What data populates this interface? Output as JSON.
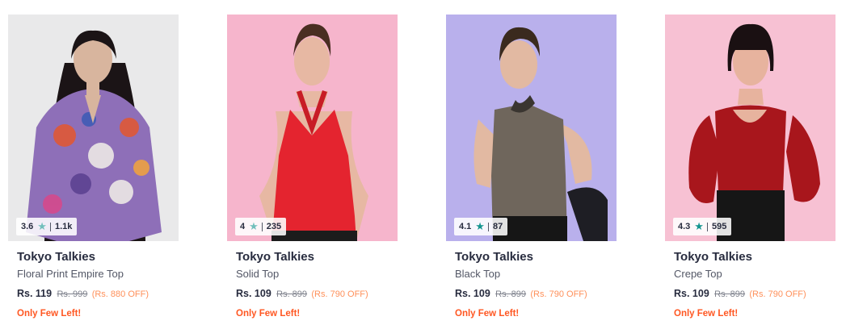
{
  "products": [
    {
      "brand": "Tokyo Talkies",
      "name": "Floral Print Empire Top",
      "rating": "3.6",
      "rating_count": "1.1k",
      "price": "Rs. 119",
      "mrp": "Rs. 999",
      "discount": "(Rs. 880 OFF)",
      "stock_note": "Only Few Left!",
      "bg_color": "#e9e9ea",
      "garment_color": "#8e6fb8",
      "star_style": "light"
    },
    {
      "brand": "Tokyo Talkies",
      "name": "Solid Top",
      "rating": "4",
      "rating_count": "235",
      "price": "Rs. 109",
      "mrp": "Rs. 899",
      "discount": "(Rs. 790 OFF)",
      "stock_note": "Only Few Left!",
      "bg_color": "#f6b5cc",
      "garment_color": "#e4242f",
      "star_style": "light"
    },
    {
      "brand": "Tokyo Talkies",
      "name": "Black Top",
      "rating": "4.1",
      "rating_count": "87",
      "price": "Rs. 109",
      "mrp": "Rs. 899",
      "discount": "(Rs. 790 OFF)",
      "stock_note": "Only Few Left!",
      "bg_color": "#b9b0ec",
      "garment_color": "#6f665c",
      "star_style": "dark"
    },
    {
      "brand": "Tokyo Talkies",
      "name": "Crepe Top",
      "rating": "4.3",
      "rating_count": "595",
      "price": "Rs. 109",
      "mrp": "Rs. 899",
      "discount": "(Rs. 790 OFF)",
      "stock_note": "Only Few Left!",
      "bg_color": "#f7c1d3",
      "garment_color": "#a8161c",
      "star_style": "dark"
    }
  ],
  "colors": {
    "rating_star": "#14958f",
    "discount": "#ff905a",
    "stock_note": "#ff5722"
  },
  "icons": {
    "rating": "star-icon"
  }
}
